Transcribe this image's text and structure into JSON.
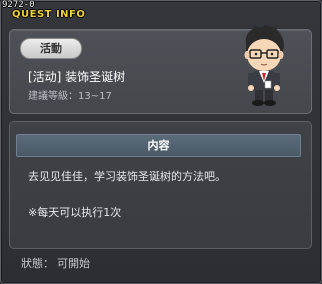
{
  "window": {
    "quest_id": "9272-0",
    "title": "QUEST INFO"
  },
  "quest": {
    "category_badge": "活動",
    "name": "[活动] 装饰圣诞树",
    "level_label": "建議等級：",
    "level_range": "13~17"
  },
  "details": {
    "header": "内容",
    "description": "去见见佳佳，学习装饰圣诞树的方法吧。",
    "note": "※每天可以执行1次"
  },
  "status": {
    "label": "狀態：",
    "value": "可開始"
  },
  "npc": {
    "icon": "npc-portrait-icon"
  },
  "colors": {
    "title_yellow": "#f0d23c",
    "header_blue": "#5b6c7a",
    "window_bg": "#2c2e33"
  }
}
